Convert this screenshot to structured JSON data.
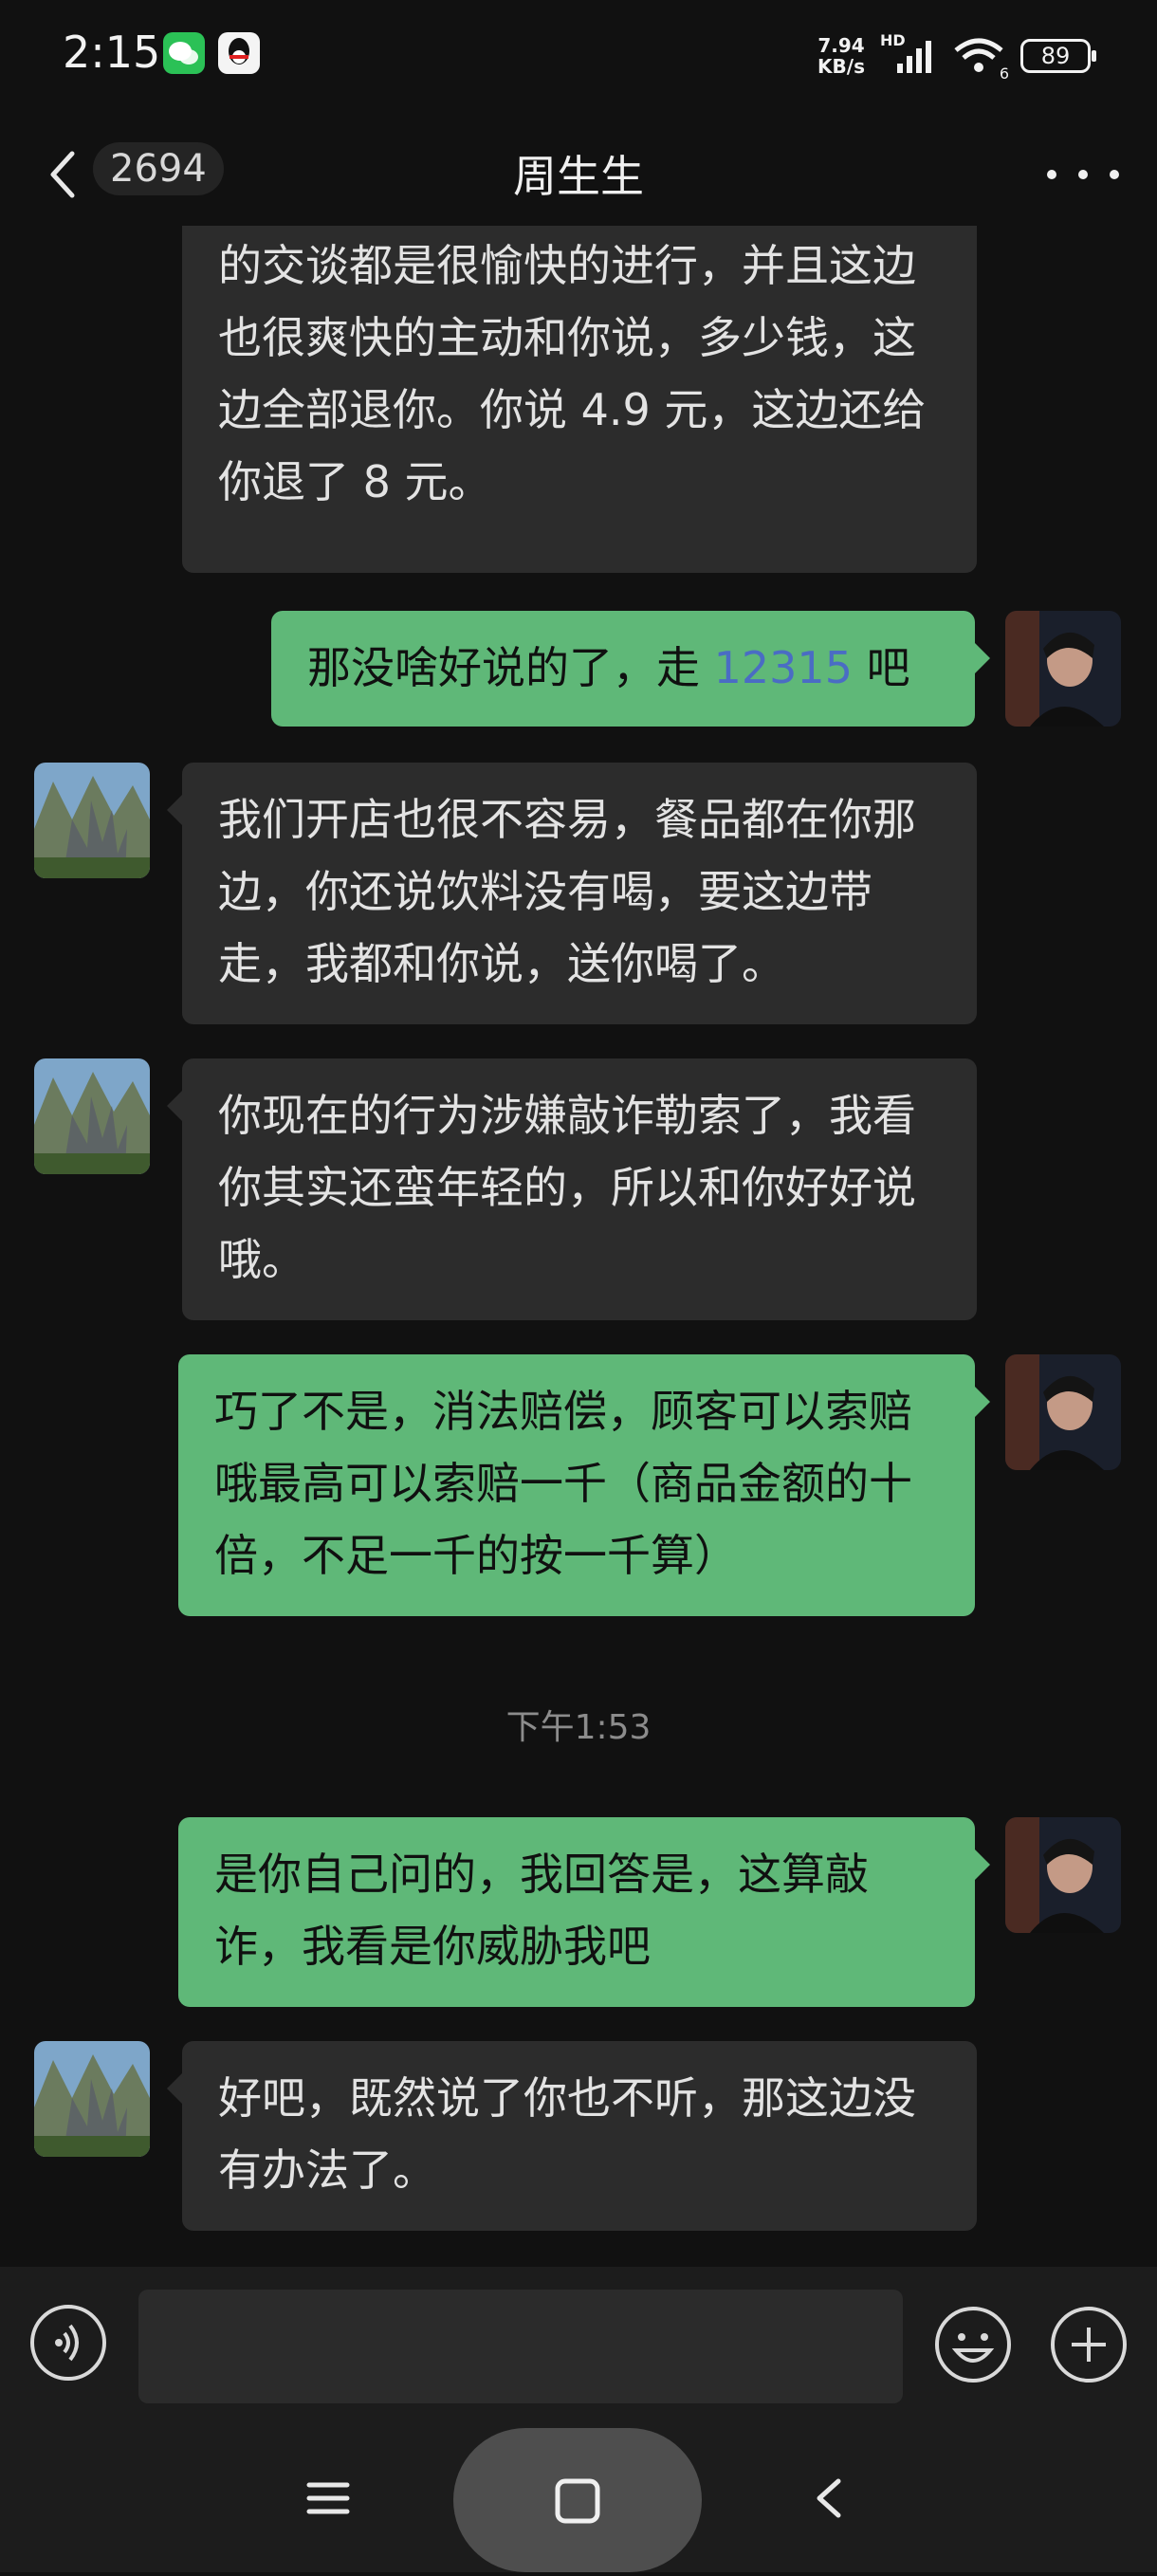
{
  "status_bar": {
    "time": "2:15",
    "net_speed_value": "7.94",
    "net_speed_unit": "KB/s",
    "hd_label": "HD",
    "wifi_label": "6",
    "battery": "89"
  },
  "nav": {
    "unread_count": "2694",
    "title": "周生生"
  },
  "messages": [
    {
      "side": "incoming",
      "text": "这就已经给你全额退款了，我们所有的交谈都是很愉快的进行，并且这边也很爽快的主动和你说，多少钱，这边全部退你。你说 4.9 元，这边还给你退了 8 元。"
    },
    {
      "side": "outgoing",
      "text_before": "那没啥好说的了，走 ",
      "link": "12315",
      "text_after": " 吧"
    },
    {
      "side": "incoming",
      "text": "我们开店也很不容易，餐品都在你那边，你还说饮料没有喝，要这边带走，我都和你说，送你喝了。"
    },
    {
      "side": "incoming",
      "text": "你现在的行为涉嫌敲诈勒索了，我看你其实还蛮年轻的，所以和你好好说哦。"
    },
    {
      "side": "outgoing",
      "text": "巧了不是，消法赔偿，顾客可以索赔哦最高可以索赔一千（商品金额的十倍，不足一千的按一千算）"
    },
    {
      "side": "outgoing",
      "text": "是你自己问的，我回答是，这算敲诈，我看是你威胁我吧"
    },
    {
      "side": "incoming",
      "text": "好吧，既然说了你也不听，那这边没有办法了。"
    }
  ],
  "timestamp": "下午1:53",
  "input": {
    "value": ""
  },
  "colors": {
    "background": "#111111",
    "incoming_bubble": "#2c2c2c",
    "outgoing_bubble": "#5fb878",
    "link": "#4a6cc4"
  },
  "icons": {
    "back": "chevron-left-icon",
    "more": "more-dots-icon",
    "voice": "voice-icon",
    "emoji": "emoji-icon",
    "plus": "plus-icon",
    "sys_menu": "menu-icon",
    "sys_home": "home-square-icon",
    "sys_back": "back-chevron-icon"
  }
}
